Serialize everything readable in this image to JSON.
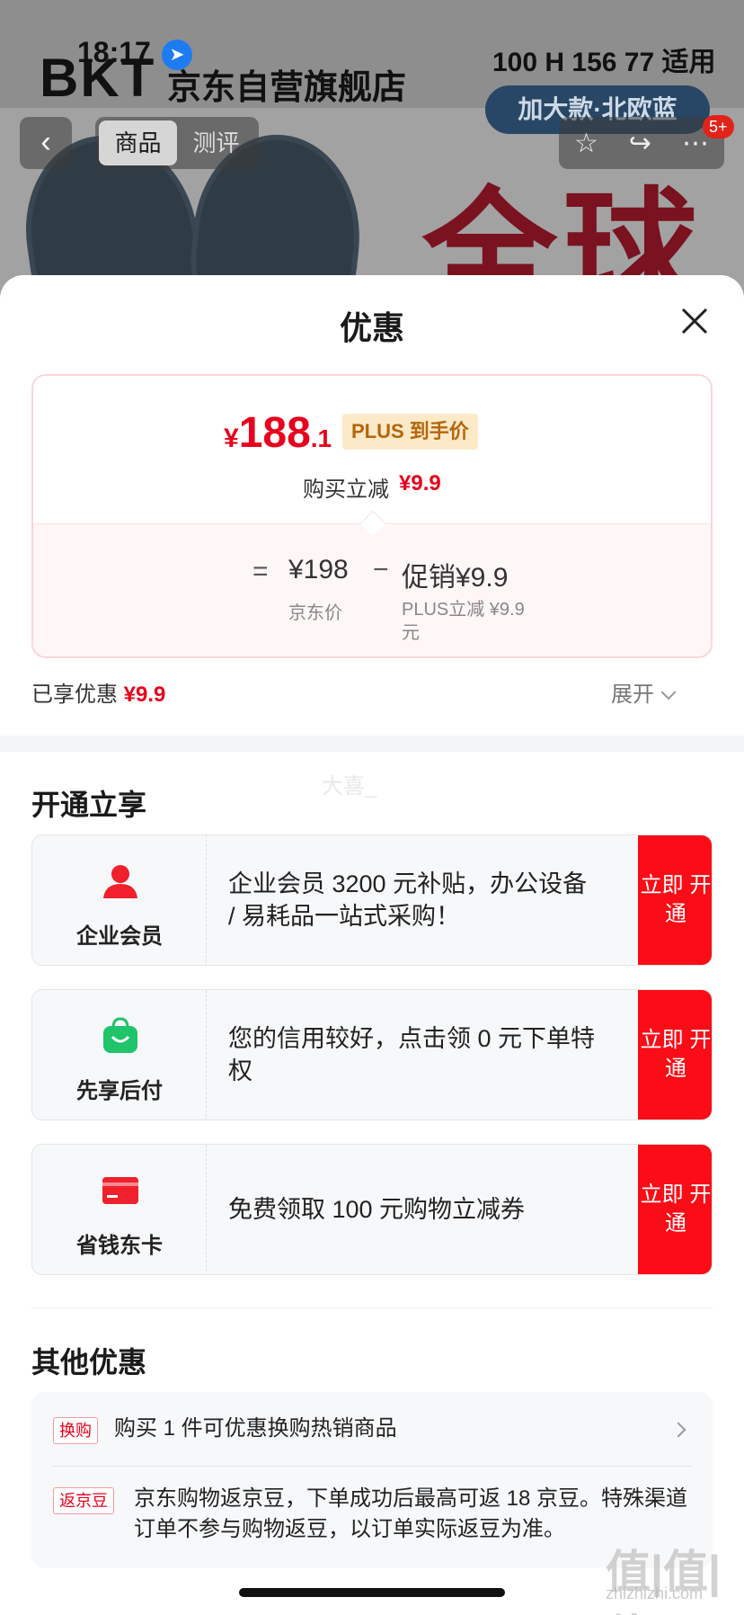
{
  "status_bar": {
    "time": "18:17",
    "right_text": "100 H 156 77 适用"
  },
  "background_page": {
    "brand": "BKT",
    "store_name": "京东自营旗舰店",
    "variant": "加大款·北欧蓝",
    "big_text": "全球",
    "tabs": [
      {
        "label": "商品"
      },
      {
        "label": "测评"
      }
    ],
    "cart_badge": "5+"
  },
  "sheet": {
    "title": "优惠",
    "price_card": {
      "final_price_symbol": "¥",
      "final_price_int": "188",
      "final_price_dec": ".1",
      "plus_tag": "PLUS 到手价",
      "instant_label": "购买立减",
      "instant_value": "¥9.9",
      "eq": "=",
      "jd_price": "¥198",
      "minus": "−",
      "promo": "促销¥9.9",
      "jd_label": "京东价",
      "plus_sub": "PLUS立减 ¥9.9元"
    },
    "enjoyed_label": "已享优惠",
    "enjoyed_value": "¥9.9",
    "expand_label": "展开",
    "watermark_text": "大喜_",
    "open_section": {
      "title": "开通立享",
      "items": [
        {
          "name": "企业会员",
          "icon": "user-icon",
          "desc": "企业会员 3200 元补贴，办公设备 / 易耗品一站式采购！",
          "button": "立即 开通",
          "icon_color": "#f0202d"
        },
        {
          "name": "先享后付",
          "icon": "shopping-bag-icon",
          "desc": "您的信用较好，点击领 0 元下单特权",
          "button": "立即 开通",
          "icon_color": "#1fc46b"
        },
        {
          "name": "省钱东卡",
          "icon": "card-icon",
          "desc": "免费领取 100 元购物立减券",
          "button": "立即 开通",
          "icon_color": "#f0202d"
        }
      ]
    },
    "other_section": {
      "title": "其他优惠",
      "items": [
        {
          "tag": "换购",
          "text": "购买 1 件可优惠换购热销商品"
        },
        {
          "tag": "返京豆",
          "text": "京东购物返京豆，下单成功后最高可返 18 京豆。特殊渠道订单不参与购物返豆，以订单实际返豆为准。"
        }
      ]
    }
  },
  "watermark": {
    "main": "值|值|值",
    "sub": "zhizhizhi.com"
  },
  "colors": {
    "accent": "#e8001c",
    "button": "#fa0d16",
    "plus_tag_bg": "#fbe9c8"
  }
}
